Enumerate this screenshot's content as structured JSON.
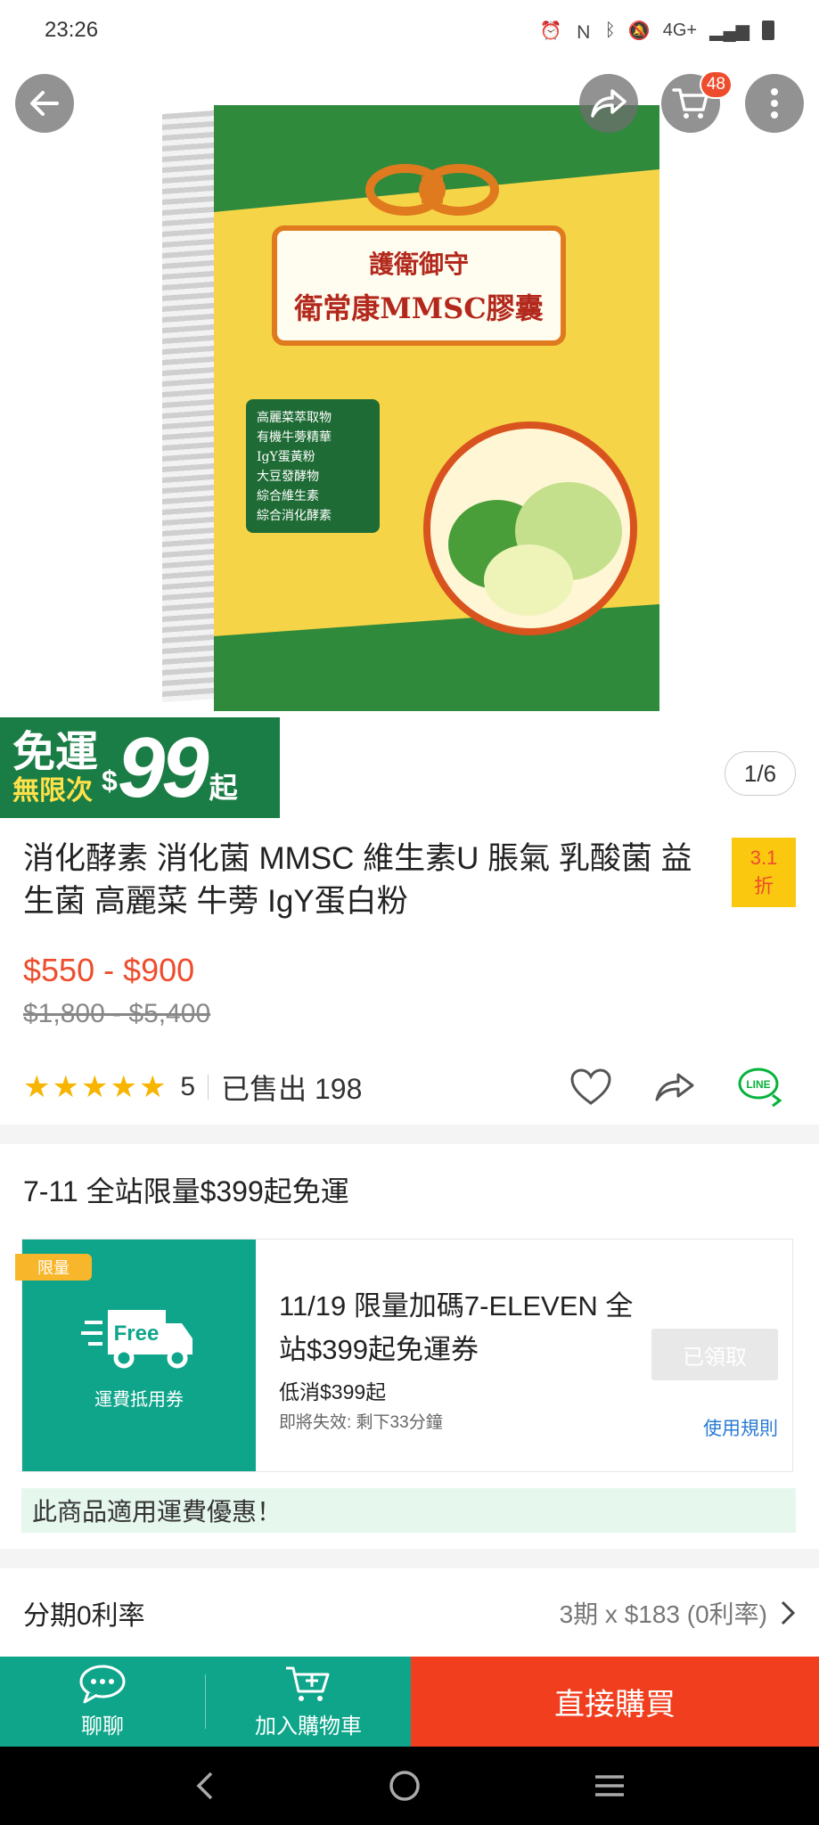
{
  "status_bar": {
    "time": "23:26",
    "network": "4G+"
  },
  "top_actions": {
    "cart_count": "48"
  },
  "product_image": {
    "label_line1": "護衛御守",
    "label_line2": "衛常康MMSC膠囊",
    "ingredients": [
      "高麗菜萃取物",
      "有機牛蒡精華",
      "IgY蛋黃粉",
      "大豆發酵物",
      "綜合維生素",
      "綜合消化酵素"
    ]
  },
  "promo": {
    "free_shipping": "免運",
    "unlimited": "無限次",
    "dollar": "$",
    "amount": "99",
    "from": "起"
  },
  "image_counter": "1/6",
  "product": {
    "title": "消化酵素 消化菌 MMSC 維生素U 脹氣 乳酸菌 益生菌 高麗菜 牛蒡 IgY蛋白粉",
    "discount_value": "3.1",
    "discount_unit": "折",
    "price": "$550 - $900",
    "original_price": "$1,800 - $5,400",
    "rating": "5",
    "stars": 5,
    "sold": "已售出 198"
  },
  "shipping": {
    "title": "7-11 全站限量$399起免運",
    "coupon": {
      "tag": "限量",
      "free_text": "Free",
      "left_label": "運費抵用券",
      "title": "11/19 限量加碼7-ELEVEN 全站$399起免運券",
      "min_spend": "低消$399起",
      "expire": "即將失效: 剩下33分鐘",
      "claimed_label": "已領取",
      "rules_link": "使用規則"
    },
    "note": "此商品適用運費優惠！"
  },
  "installment": {
    "label": "分期0利率",
    "value": "3期 x $183 (0利率)"
  },
  "action_bar": {
    "chat_label": "聊聊",
    "cart_label": "加入購物車",
    "buy_label": "直接購買"
  },
  "colors": {
    "brand_red": "#ee4d2d",
    "teal": "#0fa58b",
    "buy_red": "#f03e1e",
    "star": "#f7b500"
  }
}
